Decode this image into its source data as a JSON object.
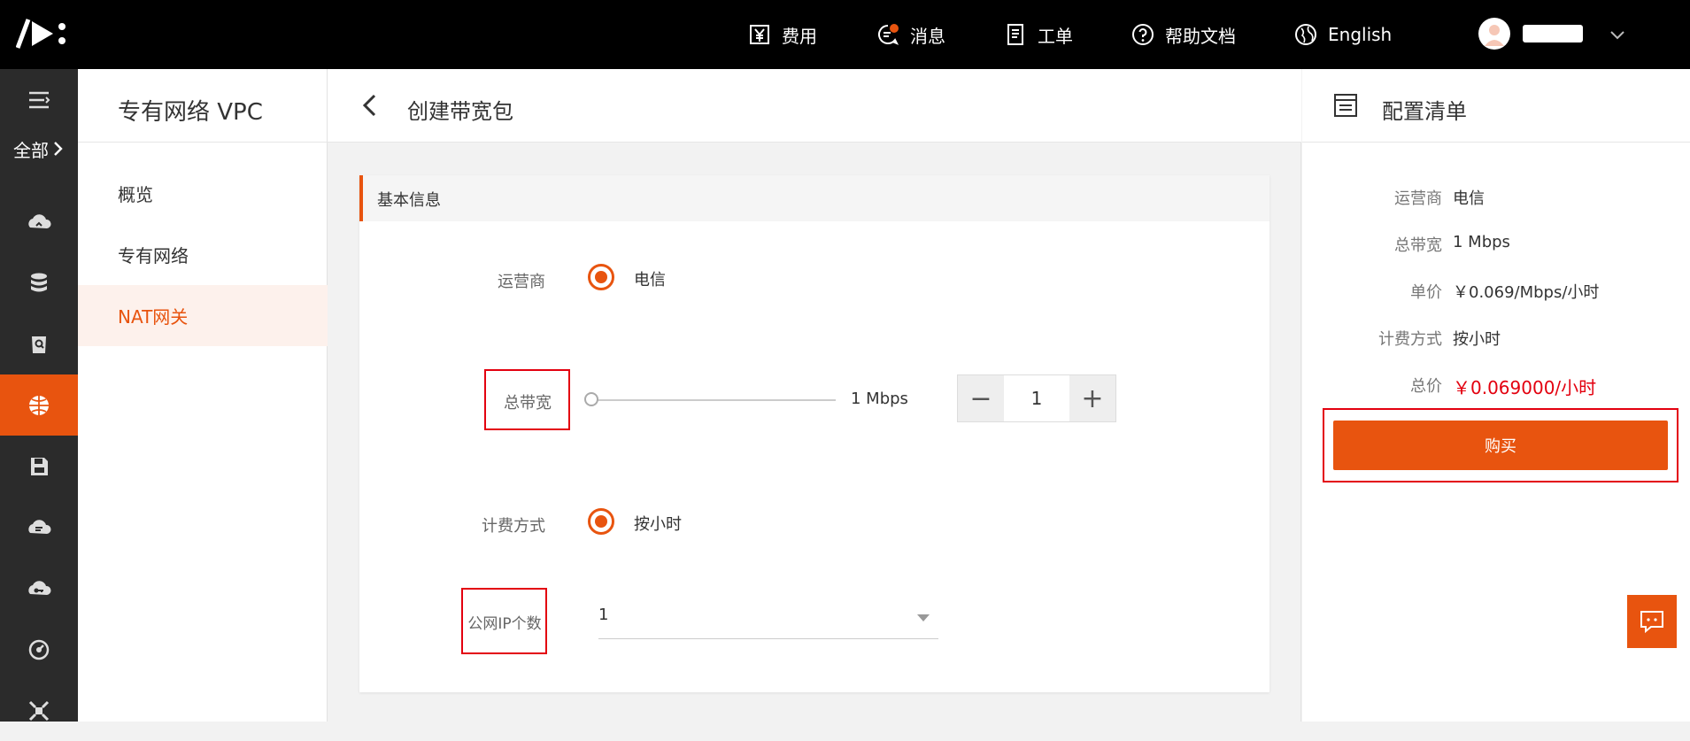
{
  "topbar": {
    "nav": [
      {
        "label": "费用",
        "icon": "yuan-icon"
      },
      {
        "label": "消息",
        "icon": "message-icon"
      },
      {
        "label": "工单",
        "icon": "ticket-icon"
      },
      {
        "label": "帮助文档",
        "icon": "help-icon"
      },
      {
        "label": "English",
        "icon": "globe-icon"
      }
    ]
  },
  "sidebar": {
    "all_label": "全部",
    "active_index": 5
  },
  "subnav": {
    "title": "专有网络 VPC",
    "items": [
      {
        "label": "概览"
      },
      {
        "label": "专有网络"
      },
      {
        "label": "NAT网关"
      }
    ],
    "active_item": "NAT网关"
  },
  "main": {
    "page_title": "创建带宽包",
    "section_title": "基本信息",
    "form": {
      "carrier_label": "运营商",
      "carrier_value": "电信",
      "bandwidth_label": "总带宽",
      "bandwidth_slider_text": "1 Mbps",
      "bandwidth_fraction": 0.0,
      "bandwidth_minus": "−",
      "bandwidth_plus": "+",
      "bandwidth_value": "1",
      "billing_label": "计费方式",
      "billing_value": "按小时",
      "ip_count_label": "公网IP个数",
      "ip_count_value": "1"
    }
  },
  "summary": {
    "title": "配置清单",
    "rows": [
      {
        "k": "运营商",
        "v": "电信"
      },
      {
        "k": "总带宽",
        "v": "1 Mbps"
      },
      {
        "k": "单价",
        "v": "￥0.069/Mbps/小时"
      },
      {
        "k": "计费方式",
        "v": "按小时"
      },
      {
        "k": "总价",
        "v": "￥0.069000/小时"
      }
    ],
    "buy_label": "购买"
  },
  "colors": {
    "accent": "#e8540f",
    "highlight": "#e3000f",
    "topbar": "#000000",
    "iconbar": "#2b2b2b"
  }
}
